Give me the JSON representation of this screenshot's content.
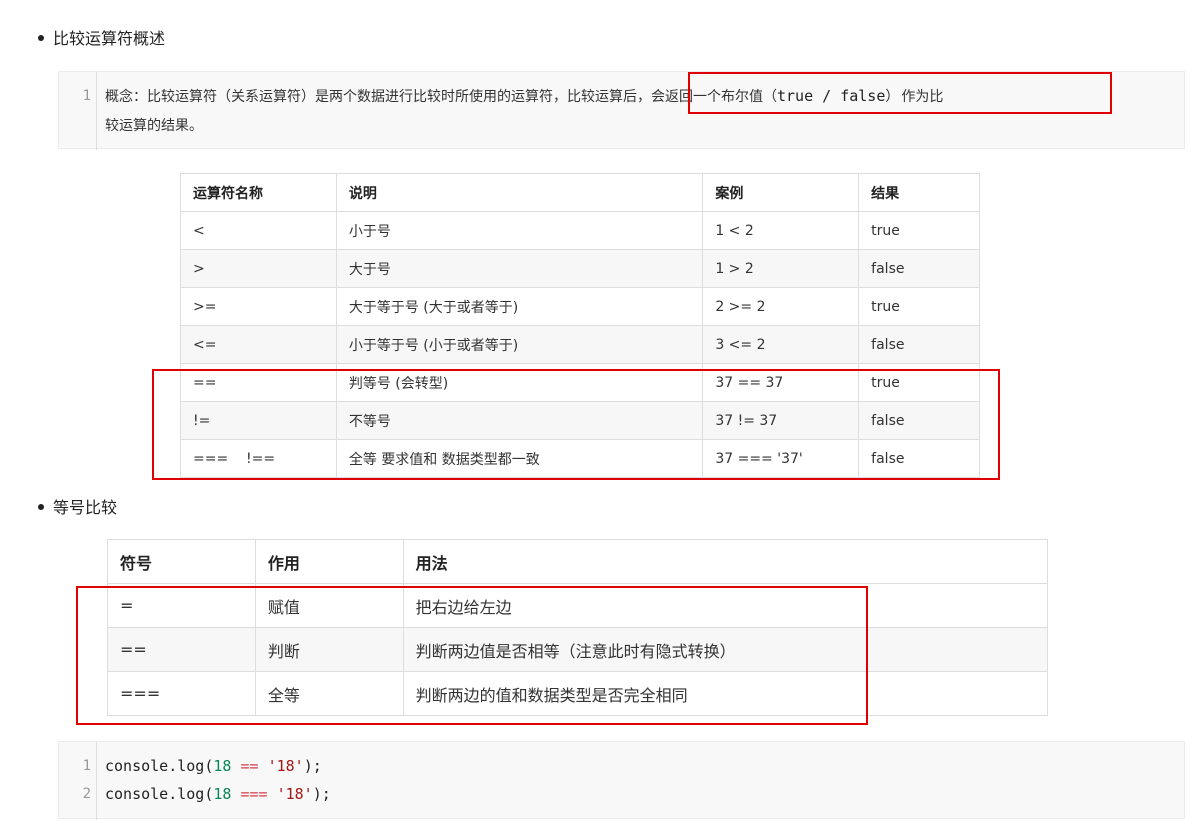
{
  "section1": {
    "bullet": "比较运算符概述"
  },
  "concept": {
    "line_number": "1",
    "text_prefix": "概念：比较运算符（关系运算符）是两个数据进行比较时所使用的运算符，",
    "text_highlight": "比较运算后，会返回一个布尔值（",
    "text_code": "true / false",
    "text_close": "）",
    "text_suffix": "作为比",
    "text_line2": "较运算的结果。"
  },
  "table1": {
    "headers": [
      "运算符名称",
      "说明",
      "案例",
      "结果"
    ],
    "rows": [
      [
        "<",
        "小于号",
        "1 < 2",
        "true"
      ],
      [
        ">",
        "大于号",
        "1 > 2",
        "false"
      ],
      [
        ">=",
        "大于等于号 (大于或者等于)",
        "2 >= 2",
        "true"
      ],
      [
        "<=",
        "小于等于号 (小于或者等于)",
        "3 <= 2",
        "false"
      ],
      [
        "==",
        "判等号 (会转型)",
        "37 == 37",
        "true"
      ],
      [
        "!=",
        "不等号",
        "37 != 37",
        "false"
      ],
      [
        "===    !==",
        "全等 要求值和 数据类型都一致",
        "37 === '37'",
        "false"
      ]
    ]
  },
  "section2": {
    "bullet": "等号比较"
  },
  "table2": {
    "headers": [
      "符号",
      "作用",
      "用法"
    ],
    "rows": [
      [
        "=",
        "赋值",
        "把右边给左边"
      ],
      [
        "==",
        "判断",
        "判断两边值是否相等（注意此时有隐式转换）"
      ],
      [
        "===",
        "全等",
        "判断两边的值和数据类型是否完全相同"
      ]
    ]
  },
  "code": {
    "lines": [
      {
        "num": "1",
        "pre": "console.log(",
        "n": "18",
        "op": " == ",
        "s": "'18'",
        "post": ");"
      },
      {
        "num": "2",
        "pre": "console.log(",
        "n": "18",
        "op": " === ",
        "s": "'18'",
        "post": ");"
      }
    ]
  },
  "colors": {
    "highlight_border": "#e00000",
    "code_bg": "#f8f8f8"
  }
}
